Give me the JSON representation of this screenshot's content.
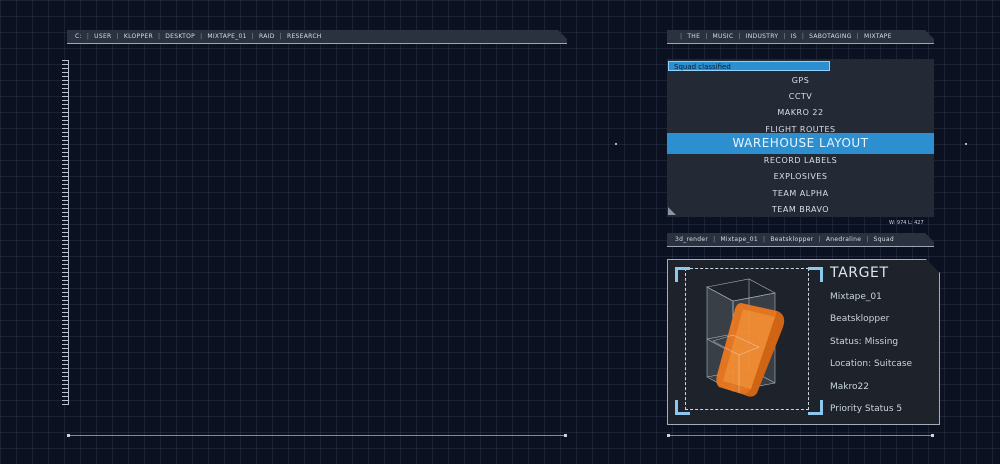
{
  "path_bar": [
    "C:",
    "USER",
    "KLOPPER",
    "DESKTOP",
    "MIXTAPE_01",
    "RAID",
    "RESEARCH"
  ],
  "title_bar": [
    "",
    "THE",
    "MUSIC",
    "INDUSTRY",
    "IS",
    "SABOTAGING",
    "MIXTAPE"
  ],
  "menu": {
    "search_value": "Squad classified",
    "items": [
      "GPS",
      "CCTV",
      "MAKRO 22",
      "FLIGHT ROUTES",
      "WAREHOUSE LAYOUT",
      "RECORD LABELS",
      "EXPLOSIVES",
      "TEAM ALPHA",
      "TEAM BRAVO"
    ],
    "selected_index": 4,
    "dims": "W: 974   L: 427"
  },
  "render_bar": [
    "3d_render",
    "Mixtape_01",
    "Beatsklopper",
    "Anedraline",
    "Squad"
  ],
  "target": {
    "title": "TARGET",
    "lines": [
      "Mixtape_01",
      "Beatsklopper",
      "Status: Missing",
      "Location: Suitcase",
      "Makro22",
      "Priority Status 5"
    ]
  },
  "colors": {
    "accent": "#2c8fd0",
    "panel": "#232a35",
    "object": "#f07a1e"
  }
}
